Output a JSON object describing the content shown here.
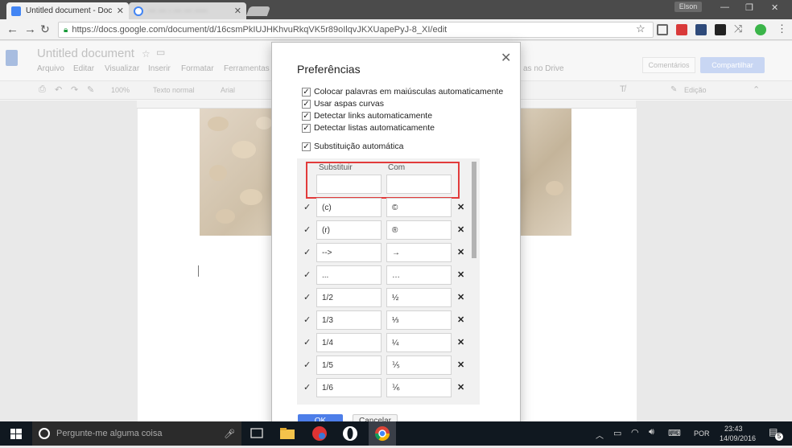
{
  "browser": {
    "tabs": [
      {
        "title": "Untitled document - Doc"
      },
      {
        "title": "··· ··· · ··· ··· ·····"
      }
    ],
    "user": "Elson",
    "url": "https://docs.google.com/document/d/16csmPkIUJHKhvuRkqVK5r89oIlqvJKXUapePyJ-8_XI/edit"
  },
  "docs": {
    "title": "Untitled document",
    "menu": [
      "Arquivo",
      "Editar",
      "Visualizar",
      "Inserir",
      "Formatar",
      "Ferramentas"
    ],
    "menu_right": "as no Drive",
    "toolbar": {
      "zoom": "100%",
      "style": "Texto normal",
      "font": "Arial",
      "mode": "Edição"
    },
    "comments_label": "Comentários",
    "share_label": "Compartilhar"
  },
  "dialog": {
    "title": "Preferências",
    "options": [
      {
        "label": "Colocar palavras em maiúsculas automaticamente",
        "checked": true
      },
      {
        "label": "Usar aspas curvas",
        "checked": true
      },
      {
        "label": "Detectar links automaticamente",
        "checked": true
      },
      {
        "label": "Detectar listas automaticamente",
        "checked": true
      }
    ],
    "substitution": {
      "label": "Substituição automática",
      "checked": true
    },
    "headers": {
      "replace": "Substituir",
      "with": "Com"
    },
    "rows": [
      {
        "from": "(c)",
        "to": "©"
      },
      {
        "from": "(r)",
        "to": "®"
      },
      {
        "from": "-->",
        "to": "→"
      },
      {
        "from": "...",
        "to": "…"
      },
      {
        "from": "1/2",
        "to": "½"
      },
      {
        "from": "1/3",
        "to": "⅓"
      },
      {
        "from": "1/4",
        "to": "¼"
      },
      {
        "from": "1/5",
        "to": "⅕"
      },
      {
        "from": "1/6",
        "to": "⅙"
      }
    ],
    "ok_label": "OK",
    "cancel_label": "Cancelar"
  },
  "taskbar": {
    "search_placeholder": "Pergunte-me alguma coisa",
    "language": "POR",
    "time": "23:43",
    "date": "14/09/2016",
    "notifications": "5"
  },
  "colors": {
    "accent": "#4d7ee9",
    "highlight": "#e23b3b",
    "taskbar": "#101820"
  }
}
